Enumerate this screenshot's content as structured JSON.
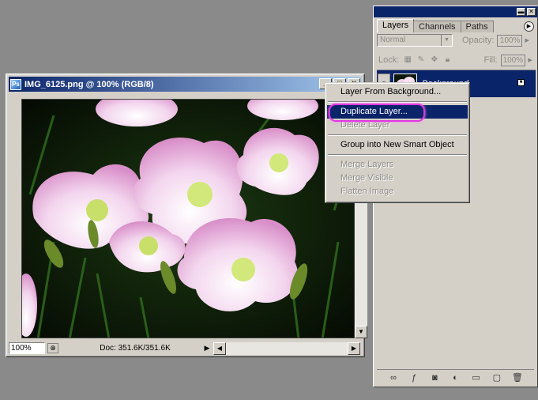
{
  "document": {
    "title": "IMG_6125.png @ 100% (RGB/8)",
    "zoom": "100%",
    "doc_info": "Doc: 351.6K/351.6K"
  },
  "context_menu": {
    "items": [
      {
        "label": "Layer From Background...",
        "enabled": true
      },
      {
        "label": "Duplicate Layer...",
        "enabled": true,
        "highlighted": true
      },
      {
        "label": "Delete Layer",
        "enabled": false
      },
      {
        "label": "Group into New Smart Object",
        "enabled": true
      },
      {
        "label": "Merge Layers",
        "enabled": false
      },
      {
        "label": "Merge Visible",
        "enabled": false
      },
      {
        "label": "Flatten Image",
        "enabled": false
      }
    ]
  },
  "layers_panel": {
    "tabs": [
      "Layers",
      "Channels",
      "Paths"
    ],
    "active_tab": "Layers",
    "blend_mode": "Normal",
    "opacity_label": "Opacity:",
    "opacity_value": "100%",
    "lock_label": "Lock:",
    "fill_label": "Fill:",
    "fill_value": "100%",
    "layers": [
      {
        "name": "Background",
        "selected": true,
        "locked": true,
        "visible": true
      }
    ]
  },
  "colors": {
    "selection": "#0a246a",
    "highlight_ring": "#e238e0",
    "ui_face": "#d4d0c8",
    "workspace": "#8a8a8a"
  }
}
